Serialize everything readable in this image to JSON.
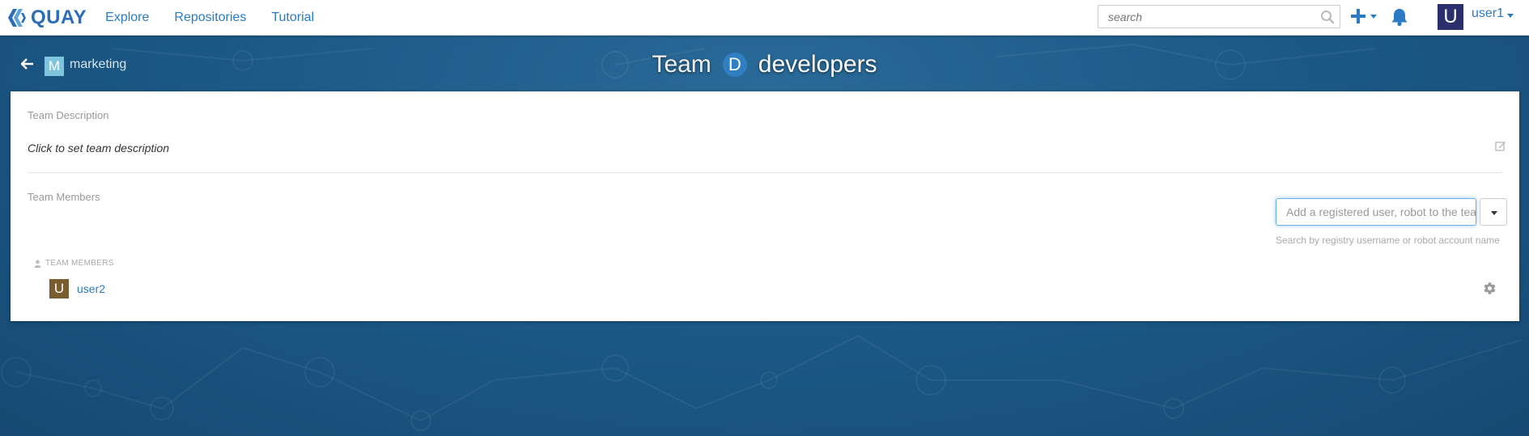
{
  "navbar": {
    "brand": "QUAY",
    "links": [
      "Explore",
      "Repositories",
      "Tutorial"
    ],
    "search_placeholder": "search",
    "user": {
      "initial": "U",
      "name": "user1"
    }
  },
  "header": {
    "org": {
      "initial": "M",
      "name": "marketing"
    },
    "title_prefix": "Team",
    "team_initial": "D",
    "team_name": "developers"
  },
  "panel": {
    "description_label": "Team Description",
    "description_placeholder": "Click to set team description",
    "members_label": "Team Members",
    "add_member_placeholder": "Add a registered user, robot to the team",
    "add_member_help": "Search by registry username or robot account name",
    "members_header": "TEAM MEMBERS",
    "members": [
      {
        "initial": "U",
        "name": "user2"
      }
    ]
  },
  "colors": {
    "accent": "#2a7bc4",
    "background": "#1c5a88",
    "user_avatar": "#2c2f6e",
    "org_avatar": "#7fc4dd",
    "team_avatar": "#2f7fc2",
    "member_avatar": "#7a5d2e"
  }
}
